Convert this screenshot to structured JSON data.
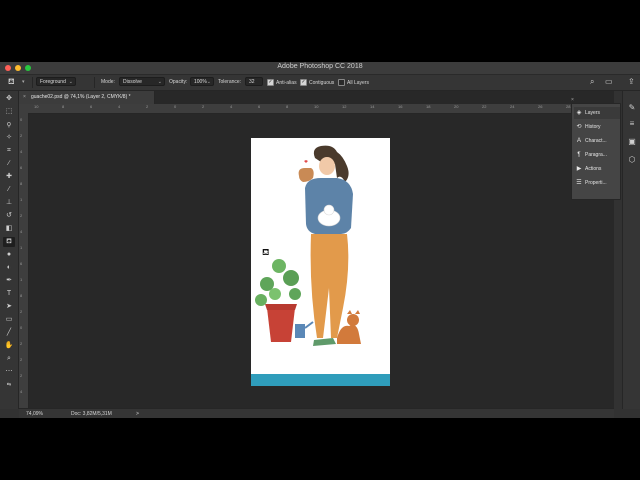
{
  "window": {
    "title": "Adobe Photoshop CC 2018"
  },
  "options_bar": {
    "tool_icon": "paint-bucket-icon",
    "fill_source": "Foreground",
    "mode_label": "Mode:",
    "mode_value": "Dissolve",
    "opacity_label": "Opacity:",
    "opacity_value": "100%",
    "tolerance_label": "Tolerance:",
    "tolerance_value": "32",
    "anti_alias_label": "Anti-alias",
    "anti_alias_checked": true,
    "contiguous_label": "Contiguous",
    "contiguous_checked": true,
    "all_layers_label": "All Layers",
    "all_layers_checked": false
  },
  "document_tab": {
    "title": "guache02.psd @ 74,1% (Layer 2, CMYK/8) *"
  },
  "ruler": {
    "horizontal_ticks": [
      "10",
      "8",
      "6",
      "4",
      "2",
      "0",
      "2",
      "4",
      "6",
      "8",
      "10",
      "12",
      "14",
      "16",
      "18",
      "20",
      "22",
      "24",
      "26",
      "28",
      "30"
    ],
    "vertical_ticks": [
      "0",
      "2",
      "4",
      "6",
      "8",
      "1",
      "2",
      "4",
      "1",
      "6",
      "1",
      "8",
      "2",
      "0",
      "2",
      "2",
      "2",
      "4"
    ]
  },
  "status_bar": {
    "zoom": "74,09%",
    "doc_info": "Doc: 3,82M/5,31M",
    "arrow": ">"
  },
  "panels": [
    {
      "label": "Layers",
      "icon": "layers-icon",
      "glyph": "◈"
    },
    {
      "label": "History",
      "icon": "history-icon",
      "glyph": "⟲"
    },
    {
      "label": "Charact...",
      "icon": "character-icon",
      "glyph": "A"
    },
    {
      "label": "Paragra...",
      "icon": "paragraph-icon",
      "glyph": "¶"
    },
    {
      "label": "Actions",
      "icon": "actions-icon",
      "glyph": "▶"
    },
    {
      "label": "Properti...",
      "icon": "properties-icon",
      "glyph": "☰"
    }
  ],
  "colors": {
    "foreground": "#4fa38c",
    "background": "#2e8dad",
    "canvas_strip": "#2f9dbb"
  }
}
